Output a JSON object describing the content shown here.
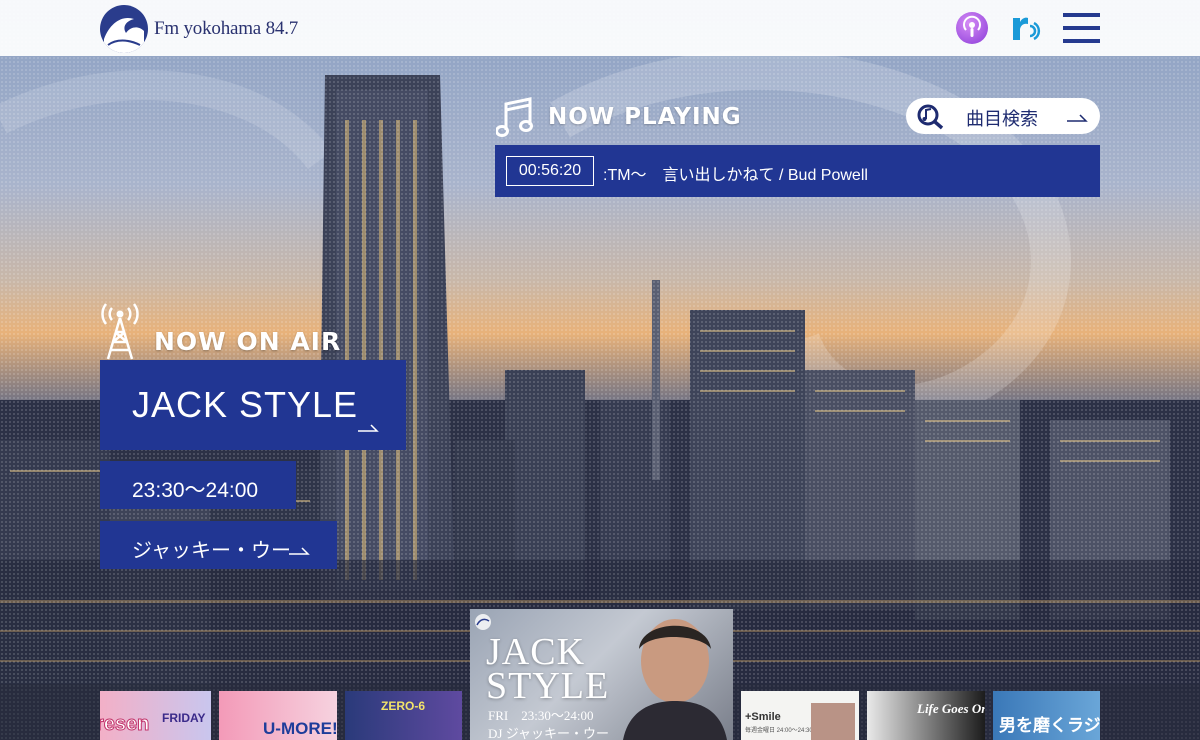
{
  "header": {
    "logo_text": "Fm yokohama 84.7",
    "podcast_icon": "podcast-icon",
    "radiko_icon": "radiko-icon",
    "menu_icon": "hamburger-menu-icon"
  },
  "now_playing": {
    "title": "NOW PLAYING",
    "search_label": "曲目検索",
    "time": "00:56:20",
    "song": ":TM～　言い出しかねて / Bud Powell"
  },
  "now_on_air": {
    "title": "NOW ON AIR",
    "program": "JACK STYLE",
    "time": "23:30～24:00",
    "dj": "ジャッキー・ウー"
  },
  "carousel": {
    "thumbs": [
      {
        "text": "resen",
        "sub": "FRIDAY"
      },
      {
        "text": "U-MORE!"
      },
      {
        "text": "ZERO-6"
      },
      {
        "text": "+Smile",
        "sub": "毎週金曜日 24:00～24:30"
      },
      {
        "text": "Life Goes On"
      },
      {
        "text": "男を磨くラジオ"
      }
    ],
    "feature": {
      "title_line1": "JACK",
      "title_line2": "STYLE",
      "time": "FRI　23:30～24:00",
      "dj": "DJ ジャッキー・ウー"
    }
  },
  "colors": {
    "brand_blue": "#213693",
    "header_bg": "#ffffff",
    "nav_blue": "#253a8f"
  }
}
